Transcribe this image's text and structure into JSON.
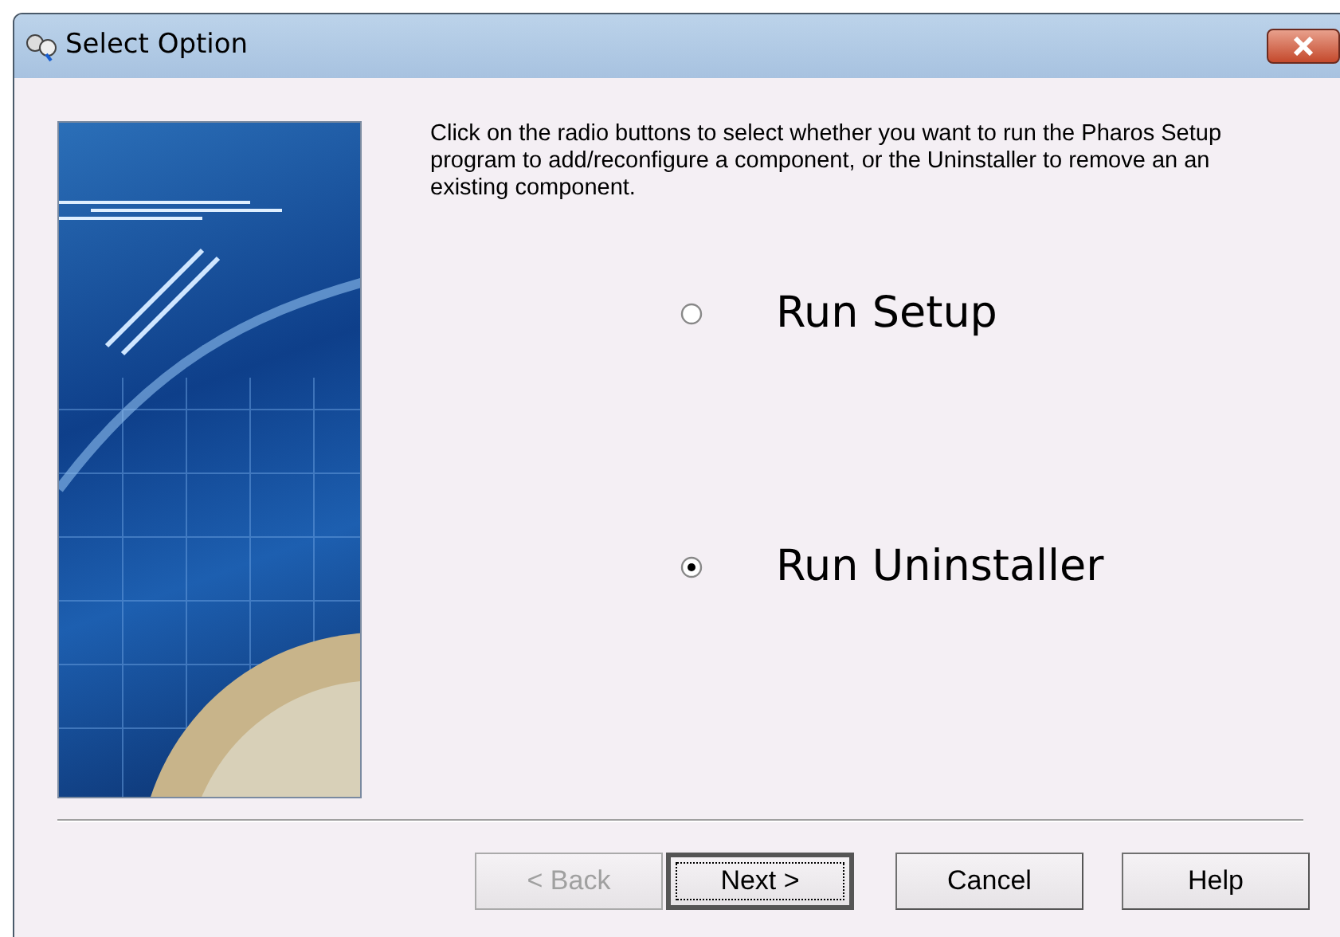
{
  "window": {
    "title": "Select Option"
  },
  "instructions": "Click on the radio buttons to select whether you want to run the Pharos Setup program to add/reconfigure a component, or the Uninstaller to remove an an existing component.",
  "options": [
    {
      "label": "Run Setup",
      "selected": false
    },
    {
      "label": "Run Uninstaller",
      "selected": true
    }
  ],
  "buttons": [
    {
      "label": "< Back",
      "disabled": true,
      "default": false
    },
    {
      "label": "Next >",
      "disabled": false,
      "default": true
    },
    {
      "label": "Cancel",
      "disabled": false,
      "default": false
    },
    {
      "label": "Help",
      "disabled": false,
      "default": false
    }
  ]
}
